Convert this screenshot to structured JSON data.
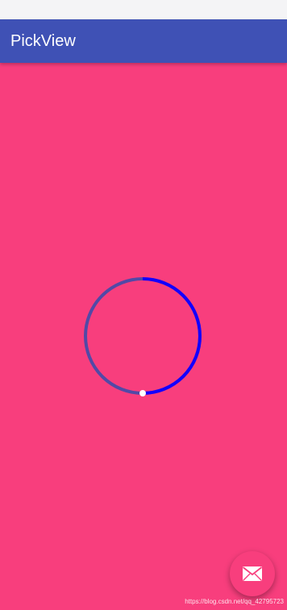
{
  "app_bar": {
    "title": "PickView"
  },
  "progress": {
    "value": 0.5,
    "track_color": "#5249a6",
    "progress_color": "#1400ff",
    "thumb_color": "#ffffff"
  },
  "fab": {
    "icon": "mail-icon"
  },
  "colors": {
    "background": "#f83e7d",
    "app_bar": "#3f51b5",
    "status_bar": "#f4f4f6"
  },
  "watermark": "https://blog.csdn.net/qq_42795723"
}
